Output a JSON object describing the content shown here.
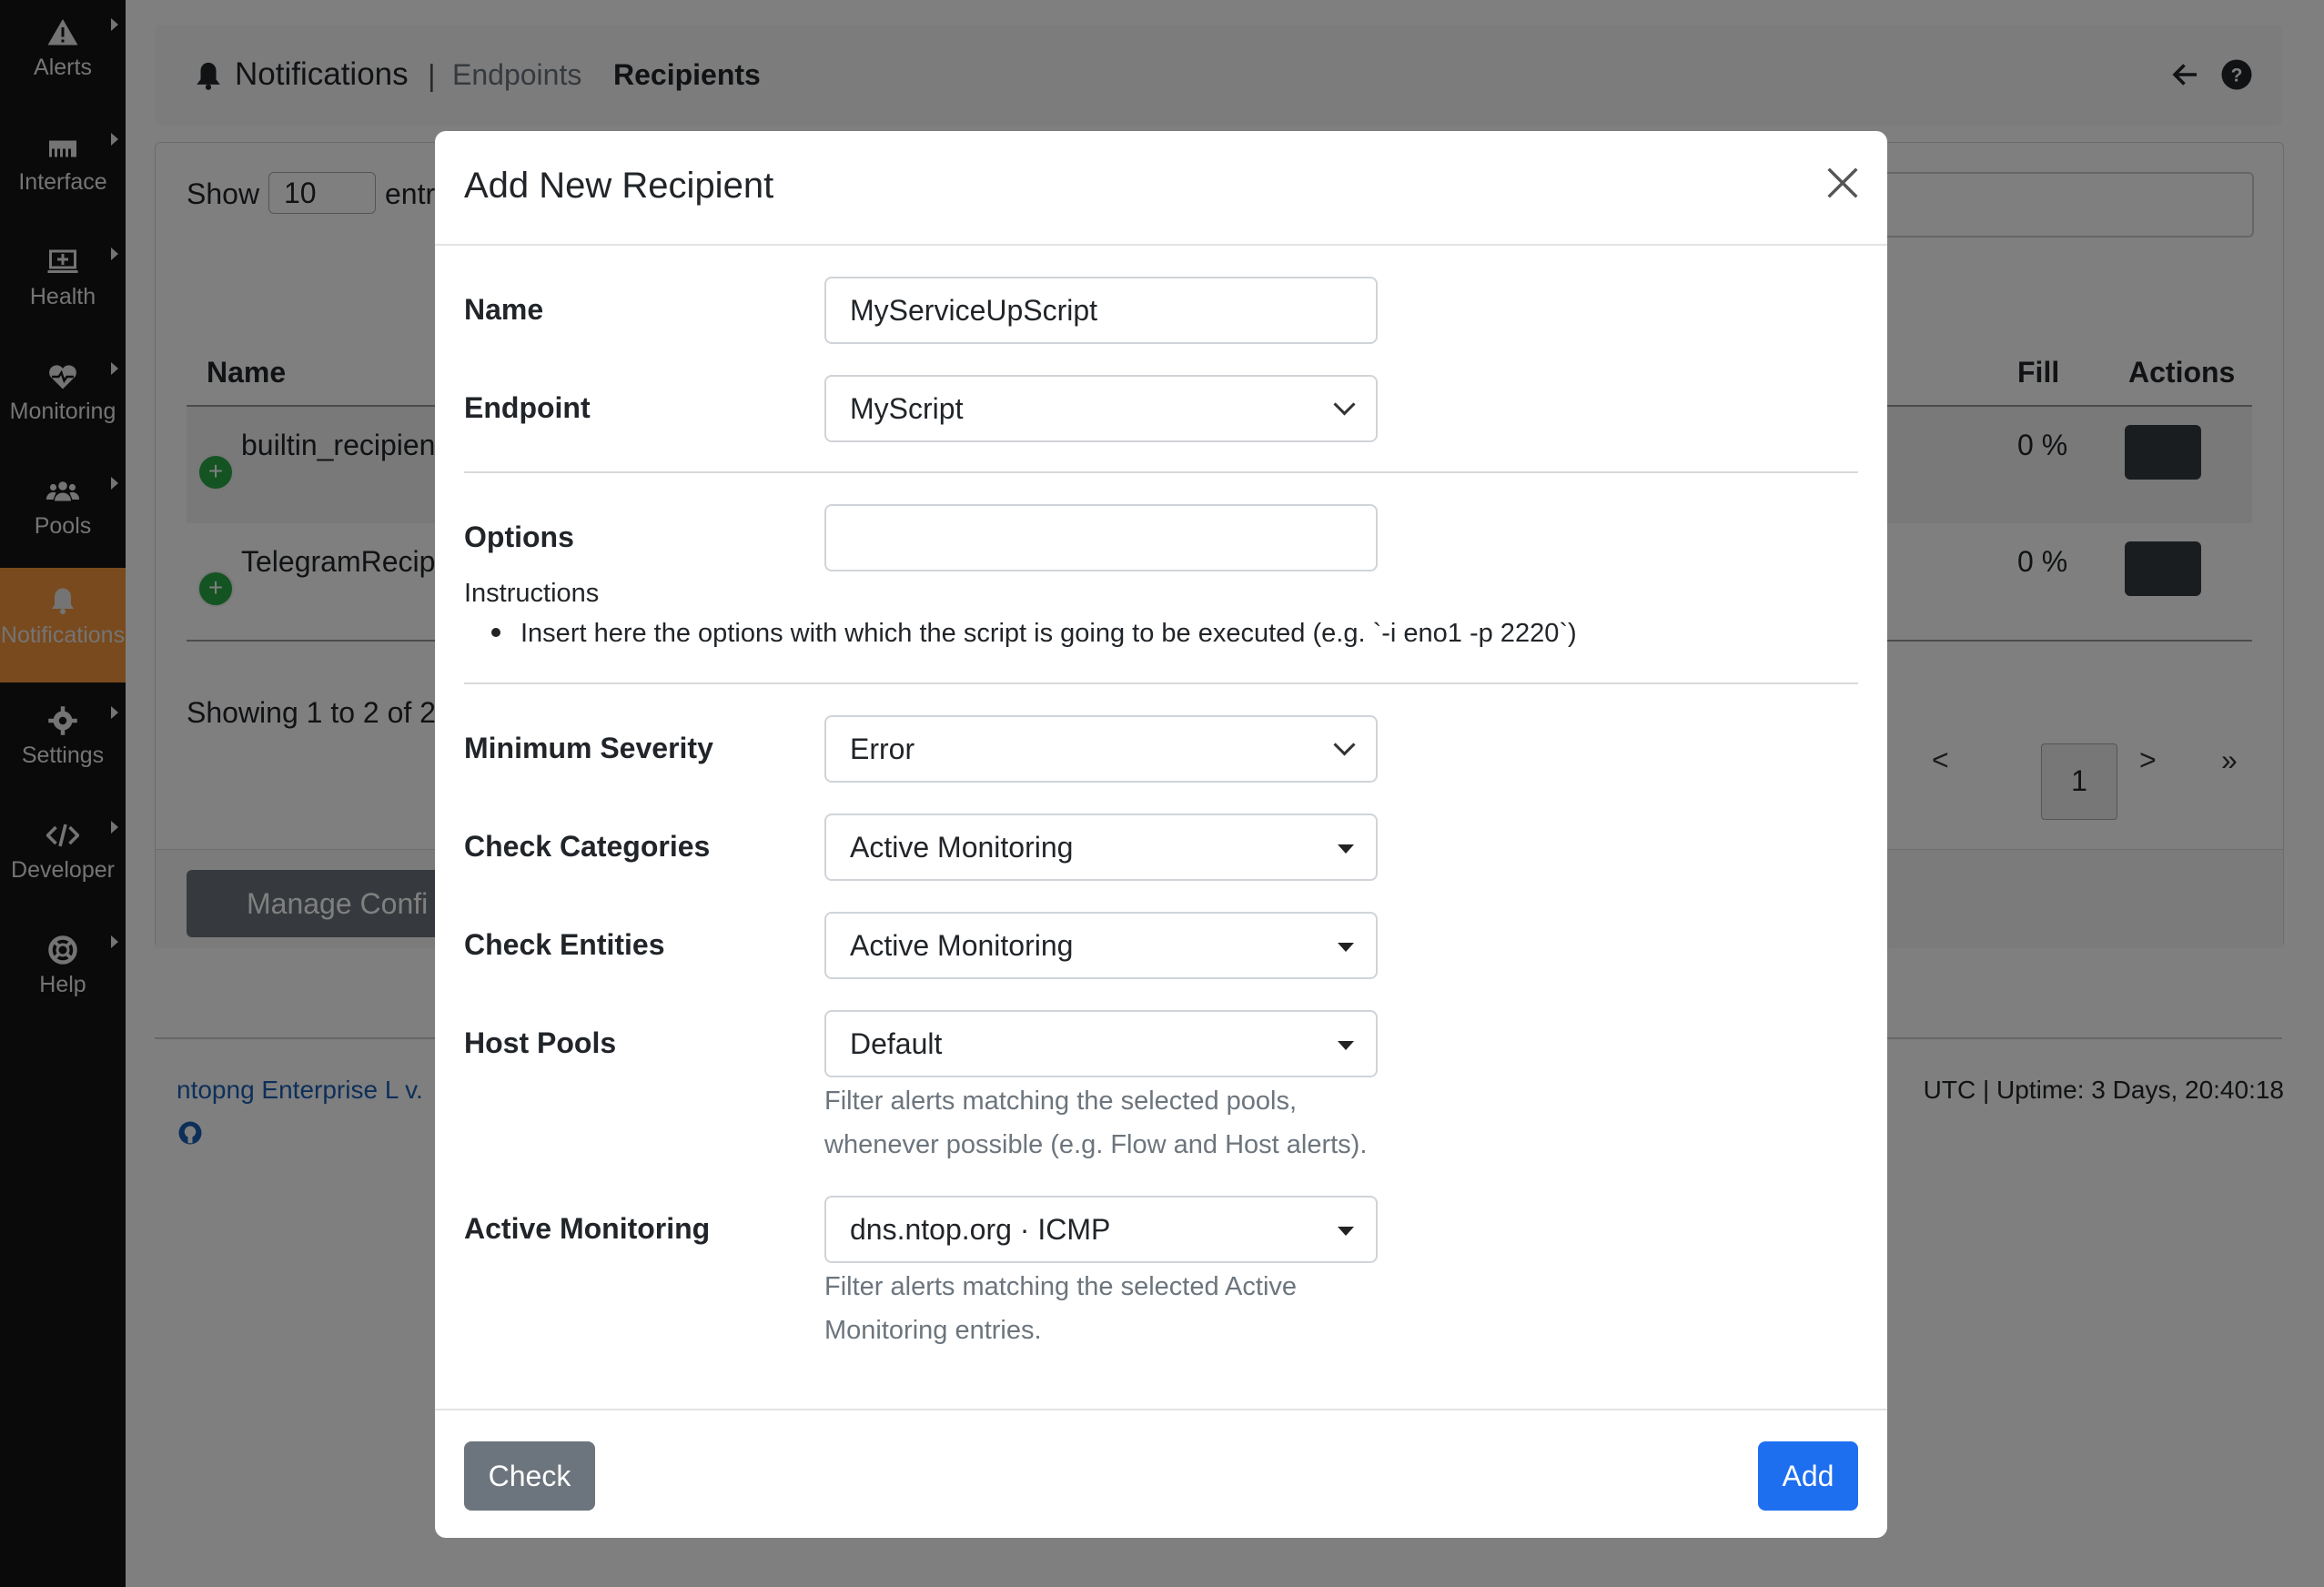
{
  "sidebar": {
    "items": [
      {
        "label": "Alerts",
        "icon": "warning-icon"
      },
      {
        "label": "Interface",
        "icon": "interface-icon"
      },
      {
        "label": "Health",
        "icon": "monitor-plus-icon"
      },
      {
        "label": "Monitoring",
        "icon": "heartbeat-icon"
      },
      {
        "label": "Pools",
        "icon": "users-icon"
      },
      {
        "label": "Notifications",
        "icon": "bell-icon"
      },
      {
        "label": "Settings",
        "icon": "gear-icon"
      },
      {
        "label": "Developer",
        "icon": "code-icon"
      },
      {
        "label": "Help",
        "icon": "lifebuoy-icon"
      }
    ],
    "active_color": "#f3943b"
  },
  "header": {
    "notifications": "Notifications",
    "separator": "|",
    "endpoints": "Endpoints",
    "recipients": "Recipients"
  },
  "table": {
    "show_label": "Show",
    "page_size": "10",
    "entries_label": "entr",
    "columns": {
      "name": "Name",
      "fill": "Fill",
      "actions": "Actions"
    },
    "rows": [
      {
        "name": "builtin_recipien",
        "fill": "0 %"
      },
      {
        "name": "TelegramRecip",
        "fill": "0 %"
      }
    ],
    "showing": "Showing 1 to 2 of 2",
    "pager": {
      "prev": "<",
      "current": "1",
      "next": ">",
      "last": "»",
      "first_partial": "‹"
    },
    "manage_button": "Manage Confi"
  },
  "footer": {
    "left": "ntopng Enterprise L v.",
    "right": "UTC | Uptime: 3 Days, 20:40:18"
  },
  "modal": {
    "title": "Add New Recipient",
    "name_label": "Name",
    "name_value": "MyServiceUpScript",
    "endpoint_label": "Endpoint",
    "endpoint_value": "MyScript",
    "options_label": "Options",
    "options_value": "",
    "instructions_title": "Instructions",
    "instructions_item": "Insert here the options with which the script is going to be executed (e.g. `-i eno1 -p 2220`)",
    "severity_label": "Minimum Severity",
    "severity_value": "Error",
    "categories_label": "Check Categories",
    "categories_value": "Active Monitoring",
    "entities_label": "Check Entities",
    "entities_value": "Active Monitoring",
    "pools_label": "Host Pools",
    "pools_value": "Default",
    "pools_help": "Filter alerts matching the selected pools, whenever possible (e.g. Flow and Host alerts).",
    "am_label": "Active Monitoring",
    "am_value": "dns.ntop.org · ICMP",
    "am_help": "Filter alerts matching the selected Active Monitoring entries.",
    "check_button": "Check",
    "add_button": "Add",
    "add_color": "#1e6ff0"
  }
}
